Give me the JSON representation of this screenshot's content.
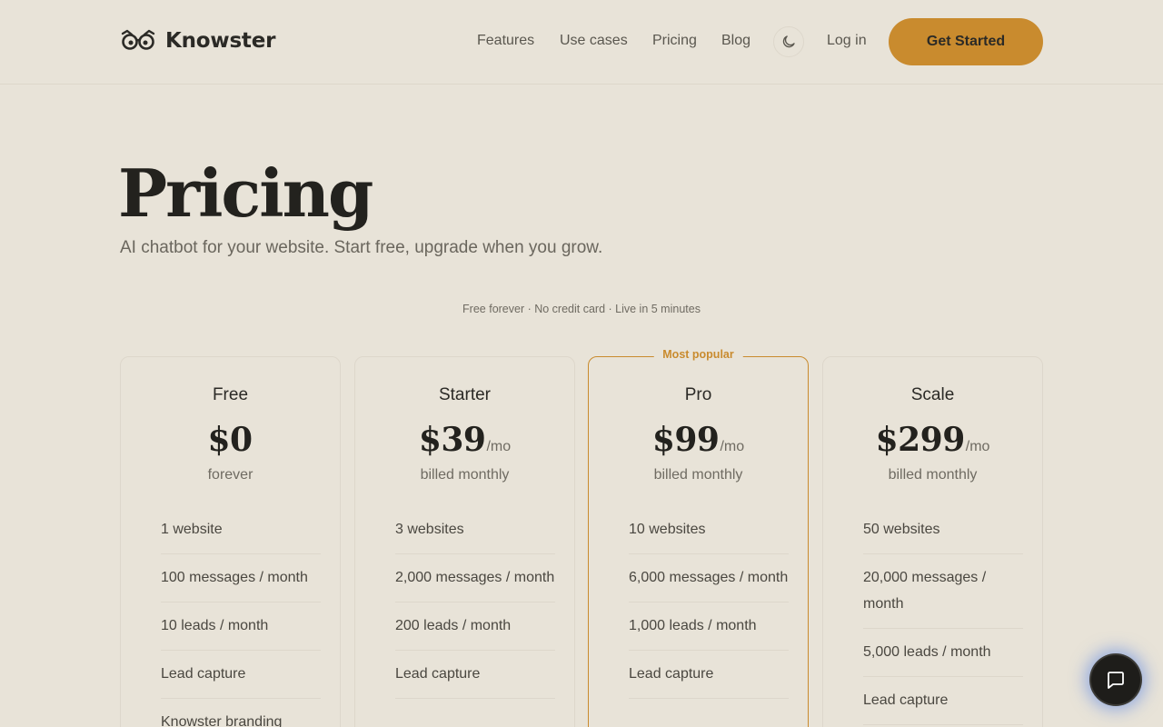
{
  "brand": {
    "name": "Knowster"
  },
  "nav": {
    "features": "Features",
    "use_cases": "Use cases",
    "pricing": "Pricing",
    "blog": "Blog",
    "login": "Log in",
    "cta": "Get Started"
  },
  "hero": {
    "title": "Pricing",
    "subtitle": "AI chatbot for your website. Start free, upgrade when you grow.",
    "tagline": "Free forever · No credit card · Live in 5 minutes"
  },
  "colors": {
    "accent": "#c98b2e",
    "background": "#e8e3d8",
    "text": "#2b2a26"
  },
  "plans": [
    {
      "name": "Free",
      "price": "$0",
      "per": "",
      "billing": "forever",
      "badge": "",
      "features": [
        "1 website",
        "100 messages / month",
        "10 leads / month",
        "Lead capture",
        "Knowster branding"
      ]
    },
    {
      "name": "Starter",
      "price": "$39",
      "per": "/mo",
      "billing": "billed monthly",
      "badge": "",
      "features": [
        "3 websites",
        "2,000 messages / month",
        "200 leads / month",
        "Lead capture"
      ]
    },
    {
      "name": "Pro",
      "price": "$99",
      "per": "/mo",
      "billing": "billed monthly",
      "badge": "Most popular",
      "features": [
        "10 websites",
        "6,000 messages / month",
        "1,000 leads / month",
        "Lead capture"
      ]
    },
    {
      "name": "Scale",
      "price": "$299",
      "per": "/mo",
      "billing": "billed monthly",
      "badge": "",
      "features": [
        "50 websites",
        "20,000 messages / month",
        "5,000 leads / month",
        "Lead capture"
      ]
    }
  ],
  "icons": {
    "logo": "owl-glasses-icon",
    "theme": "moon-icon",
    "chat": "chat-bubble-icon"
  }
}
